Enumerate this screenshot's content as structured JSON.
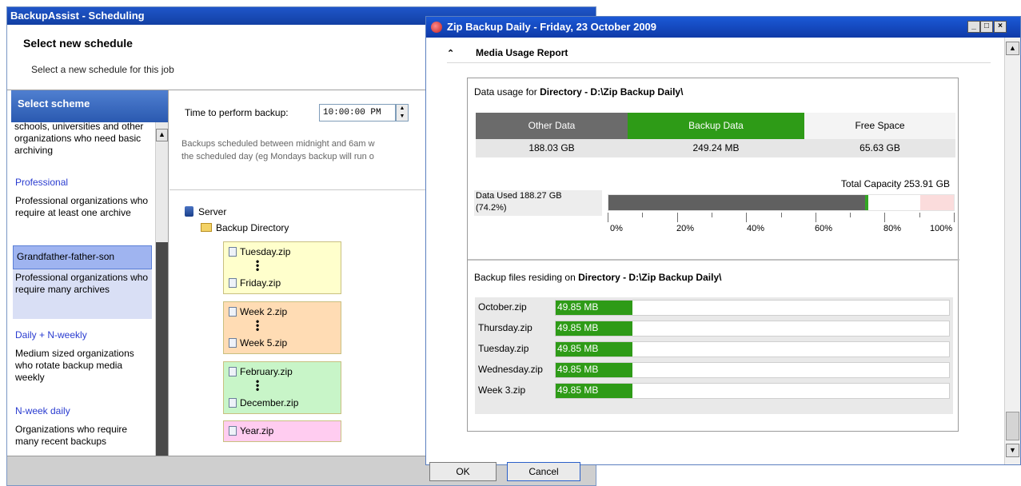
{
  "left_window": {
    "title": "BackupAssist - Scheduling",
    "header_title": "Select new schedule",
    "header_subtitle": "Select a new schedule for this job",
    "scheme_panel_title": "Select scheme",
    "schemes": [
      {
        "desc": "schools, universities and other organizations who need basic archiving"
      },
      {
        "name": "Professional",
        "desc": "Professional organizations who require at least one archive"
      },
      {
        "name": "Grandfather-father-son",
        "desc": "Professional organizations who require many archives",
        "selected": true
      },
      {
        "name": "Daily + N-weekly",
        "desc": "Medium sized organizations who rotate backup media weekly"
      },
      {
        "name": "N-week daily",
        "desc": "Organizations who require many recent backups"
      }
    ],
    "time_label": "Time to perform backup:",
    "time_value": "10:00:00 PM",
    "note_line1": "Backups scheduled between midnight and 6am w",
    "note_line2": "the scheduled day (eg Mondays backup will run o",
    "tree": {
      "server": "Server",
      "directory": "Backup Directory",
      "groups": [
        {
          "files": [
            "Tuesday.zip",
            "Friday.zip"
          ],
          "color": "#ffffcc"
        },
        {
          "files": [
            "Week 2.zip",
            "Week 5.zip"
          ],
          "color": "#ffdcb4"
        },
        {
          "files": [
            "February.zip",
            "December.zip"
          ],
          "color": "#c8f5c8"
        },
        {
          "files": [
            "Year.zip"
          ],
          "color": "#ffccf0"
        }
      ]
    }
  },
  "right_window": {
    "title": "Zip Backup Daily - Friday, 23 October 2009",
    "section_title": "Media Usage Report",
    "usage_prefix": "Data usage for ",
    "usage_target": "Directory - D:\\Zip Backup Daily\\",
    "columns": [
      {
        "header": "Other Data",
        "value": "188.03 GB",
        "color": "#6b6b6b"
      },
      {
        "header": "Backup Data",
        "value": "249.24 MB",
        "color": "#2e9b17"
      },
      {
        "header": "Free Space",
        "value": "65.63 GB",
        "color": "#f4f4f4"
      }
    ],
    "total_capacity": "Total Capacity 253.91 GB",
    "data_used_line1": "Data Used 188.27 GB",
    "data_used_line2": "(74.2%)",
    "used_fraction": 0.742,
    "tick_labels": [
      "0%",
      "20%",
      "40%",
      "60%",
      "80%",
      "100%"
    ],
    "files_prefix": "Backup files residing on ",
    "files_target": "Directory - D:\\Zip Backup Daily\\",
    "files": [
      {
        "name": "October.zip",
        "size": "49.85 MB"
      },
      {
        "name": "Thursday.zip",
        "size": "49.85 MB"
      },
      {
        "name": "Tuesday.zip",
        "size": "49.85 MB"
      },
      {
        "name": "Wednesday.zip",
        "size": "49.85 MB"
      },
      {
        "name": "Week 3.zip",
        "size": "49.85 MB"
      }
    ]
  },
  "buttons": {
    "ok": "OK",
    "cancel": "Cancel"
  }
}
